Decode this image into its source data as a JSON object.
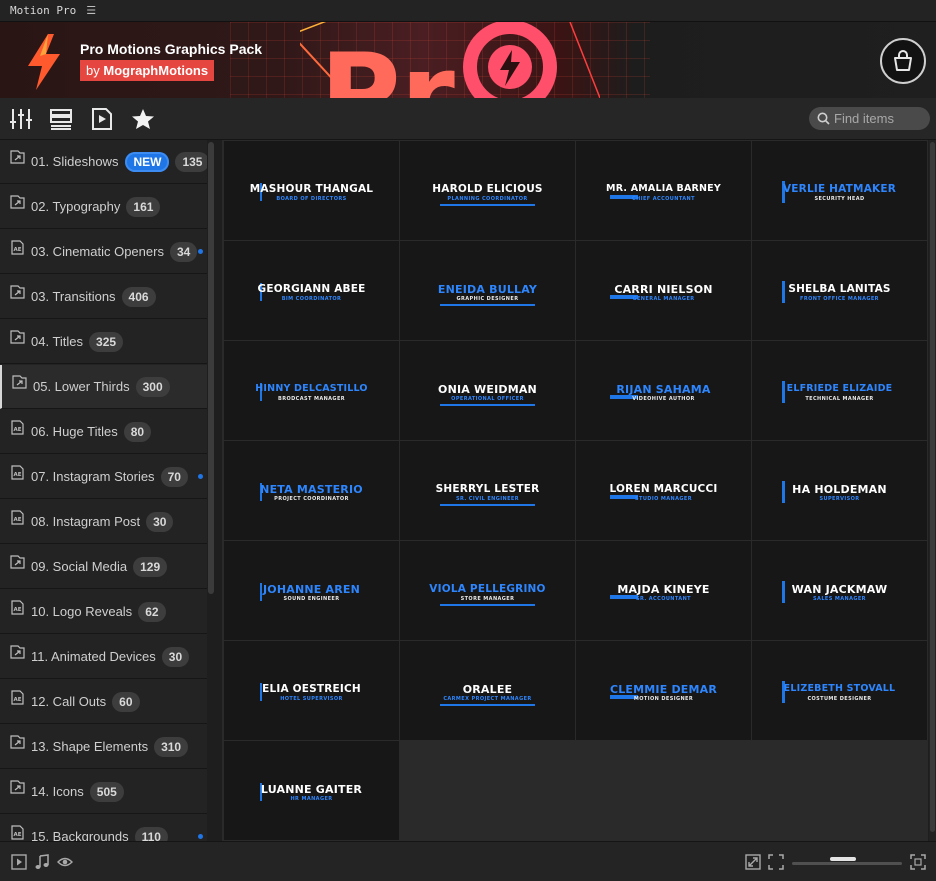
{
  "titlebar": {
    "title": "Motion Pro",
    "menu_glyph": "☰"
  },
  "banner": {
    "pack_title": "Pro Motions Graphics Pack",
    "by_prefix": "by",
    "author": "MographMotions",
    "accent": "#e5463f",
    "icons": [
      "lightning-bolt-icon",
      "shopping-bag-icon"
    ]
  },
  "toolbar": {
    "icons": [
      "sliders-icon",
      "list-view-icon",
      "media-file-icon",
      "star-icon"
    ],
    "search_placeholder": "Find items"
  },
  "sidebar": {
    "items": [
      {
        "label": "01. Slideshows",
        "count": "135",
        "badge": "NEW",
        "icon": "folder-link-icon",
        "dot": false
      },
      {
        "label": "02. Typography",
        "count": "161",
        "icon": "folder-link-icon",
        "dot": false
      },
      {
        "label": "03. Cinematic Openers",
        "count": "34",
        "icon": "ae-file-icon",
        "dot": true
      },
      {
        "label": "03. Transitions",
        "count": "406",
        "icon": "folder-link-icon",
        "dot": false
      },
      {
        "label": "04. Titles",
        "count": "325",
        "icon": "folder-link-icon",
        "dot": false
      },
      {
        "label": "05. Lower Thirds",
        "count": "300",
        "icon": "folder-link-icon",
        "dot": false,
        "active": true
      },
      {
        "label": "06. Huge Titles",
        "count": "80",
        "icon": "ae-file-icon",
        "dot": false
      },
      {
        "label": "07. Instagram Stories",
        "count": "70",
        "icon": "ae-file-icon",
        "dot": true
      },
      {
        "label": "08. Instagram Post",
        "count": "30",
        "icon": "ae-file-icon",
        "dot": false
      },
      {
        "label": "09. Social Media",
        "count": "129",
        "icon": "folder-link-icon",
        "dot": false
      },
      {
        "label": "10. Logo Reveals",
        "count": "62",
        "icon": "ae-file-icon",
        "dot": false
      },
      {
        "label": "11. Animated Devices",
        "count": "30",
        "icon": "folder-link-icon",
        "dot": false
      },
      {
        "label": "12. Call Outs",
        "count": "60",
        "icon": "ae-file-icon",
        "dot": false
      },
      {
        "label": "13. Shape Elements",
        "count": "310",
        "icon": "folder-link-icon",
        "dot": false
      },
      {
        "label": "14. Icons",
        "count": "505",
        "icon": "folder-link-icon",
        "dot": false
      },
      {
        "label": "15. Backgrounds",
        "count": "110",
        "icon": "ae-file-icon",
        "dot": true
      }
    ]
  },
  "tiles": [
    {
      "name": "MASHOUR THANGAL",
      "sub": "BOARD OF DIRECTORS",
      "color": "#ffffff",
      "accent": "#1f76e6"
    },
    {
      "name": "HAROLD ELICIOUS",
      "sub": "PLANNING COORDINATOR",
      "color": "#ffffff",
      "accent": "#1f76e6"
    },
    {
      "name": "MR. AMALIA BARNEY",
      "sub": "CHIEF ACCOUNTANT",
      "color": "#ffffff",
      "accent": "#1f76e6"
    },
    {
      "name": "VERLIE HATMAKER",
      "sub": "SECURITY HEAD",
      "color": "#2e86ff",
      "accent": "#1f76e6"
    },
    {
      "name": "GEORGIANN ABEE",
      "sub": "BIM COORDINATOR",
      "color": "#ffffff",
      "accent": "#1f76e6"
    },
    {
      "name": "ENEIDA BULLAY",
      "sub": "GRAPHIC DESIGNER",
      "color": "#2e86ff",
      "accent": "#1f76e6"
    },
    {
      "name": "CARRI NIELSON",
      "sub": "GENERAL MANAGER",
      "color": "#ffffff",
      "accent": "#1f76e6"
    },
    {
      "name": "SHELBA LANITAS",
      "sub": "FRONT OFFICE MANAGER",
      "color": "#ffffff",
      "accent": "#1f76e6"
    },
    {
      "name": "HINNY DELCASTILLO",
      "sub": "BRODCAST MANAGER",
      "color": "#2e86ff",
      "accent": "#1f76e6"
    },
    {
      "name": "ONIA WEIDMAN",
      "sub": "OPERATIONAL OFFICER",
      "color": "#ffffff",
      "accent": "#1f76e6"
    },
    {
      "name": "RIJAN SAHAMA",
      "sub": "VIDEOHIVE AUTHOR",
      "color": "#2e86ff",
      "accent": "#1f76e6"
    },
    {
      "name": "ELFRIEDE ELIZAIDE",
      "sub": "TECHNICAL MANAGER",
      "color": "#2e86ff",
      "accent": "#1f76e6"
    },
    {
      "name": "NETA MASTERIO",
      "sub": "PROJECT COORDINATOR",
      "color": "#2e86ff",
      "accent": "#1f76e6"
    },
    {
      "name": "SHERRYL LESTER",
      "sub": "SR. CIVIL ENGINEER",
      "color": "#ffffff",
      "accent": "#1f76e6"
    },
    {
      "name": "LOREN MARCUCCI",
      "sub": "STUDIO MANAGER",
      "color": "#ffffff",
      "accent": "#1f76e6"
    },
    {
      "name": "HA HOLDEMAN",
      "sub": "SUPERVISOR",
      "color": "#ffffff",
      "accent": "#1f76e6"
    },
    {
      "name": "JOHANNE AREN",
      "sub": "SOUND ENGINEER",
      "color": "#2e86ff",
      "accent": "#1f76e6"
    },
    {
      "name": "VIOLA PELLEGRINO",
      "sub": "STORE MANAGER",
      "color": "#2e86ff",
      "accent": "#1f76e6"
    },
    {
      "name": "MAJDA KINEYE",
      "sub": "SR. ACCOUNTANT",
      "color": "#ffffff",
      "accent": "#1f76e6"
    },
    {
      "name": "WAN JACKMAW",
      "sub": "SALES MANAGER",
      "color": "#ffffff",
      "accent": "#1f76e6"
    },
    {
      "name": "ELIA OESTREICH",
      "sub": "HOTEL SUPERVISOR",
      "color": "#ffffff",
      "accent": "#1f76e6"
    },
    {
      "name": "ORALEE",
      "sub": "CARMEX PROJECT MANAGER",
      "color": "#ffffff",
      "accent": "#1f76e6"
    },
    {
      "name": "CLEMMIE DEMAR",
      "sub": "MOTION DESIGNER",
      "color": "#2e86ff",
      "accent": "#1f76e6"
    },
    {
      "name": "ELIZEBETH STOVALL",
      "sub": "COSTUME DESIGNER",
      "color": "#2e86ff",
      "accent": "#1f76e6"
    },
    {
      "name": "LUANNE GAITER",
      "sub": "HR MANAGER",
      "color": "#ffffff",
      "accent": "#1f76e6"
    }
  ],
  "bottombar": {
    "icons": [
      "play-icon",
      "music-note-icon",
      "eye-icon",
      "fit-to-screen-icon",
      "expand-icon",
      "fullscreen-icon"
    ],
    "zoom_slider": 0.45
  }
}
